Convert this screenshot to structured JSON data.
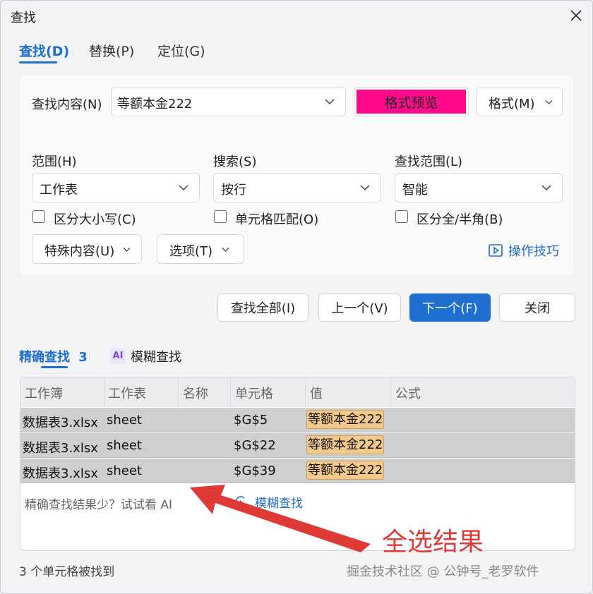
{
  "dialog": {
    "title": "查找"
  },
  "tabs": [
    {
      "label": "查找(D)",
      "active": true
    },
    {
      "label": "替换(P)"
    },
    {
      "label": "定位(G)"
    }
  ],
  "find": {
    "label": "查找内容(N)",
    "value": "等额本金222",
    "preview_label": "格式预览",
    "preview_color": "#ff0a8c",
    "format_label": "格式(M)"
  },
  "options": {
    "scope": {
      "label": "范围(H)",
      "value": "工作表"
    },
    "search": {
      "label": "搜索(S)",
      "value": "按行"
    },
    "lookin": {
      "label": "查找范围(L)",
      "value": "智能"
    },
    "match_case": "区分大小写(C)",
    "match_cell": "单元格匹配(O)",
    "match_width": "区分全/半角(B)",
    "special": "特殊内容(U)",
    "more": "选项(T)",
    "tips": "操作技巧"
  },
  "actions": {
    "find_all": "查找全部(I)",
    "prev": "上一个(V)",
    "next": "下一个(F)",
    "close": "关闭"
  },
  "result_tabs": {
    "exact": "精确查找",
    "exact_count": "3",
    "ai_badge": "AI",
    "fuzzy": "模糊查找"
  },
  "results": {
    "headers": [
      "工作簿",
      "工作表",
      "名称",
      "单元格",
      "值",
      "公式"
    ],
    "rows": [
      {
        "workbook": "数据表3.xlsx",
        "sheet": "sheet",
        "name": "",
        "cell": "$G$5",
        "value": "等额本金222",
        "formula": ""
      },
      {
        "workbook": "数据表3.xlsx",
        "sheet": "sheet",
        "name": "",
        "cell": "$G$22",
        "value": "等额本金222",
        "formula": ""
      },
      {
        "workbook": "数据表3.xlsx",
        "sheet": "sheet",
        "name": "",
        "cell": "$G$39",
        "value": "等额本金222",
        "formula": ""
      }
    ],
    "hint": "精确查找结果少？试试看 AI",
    "fuzzy_link": "模糊查找"
  },
  "status": "3 个单元格被找到",
  "watermark": "掘金技术社区 @ 公钟号_老罗软件",
  "annotation": {
    "text": "全选结果",
    "color": "#e03a36"
  }
}
